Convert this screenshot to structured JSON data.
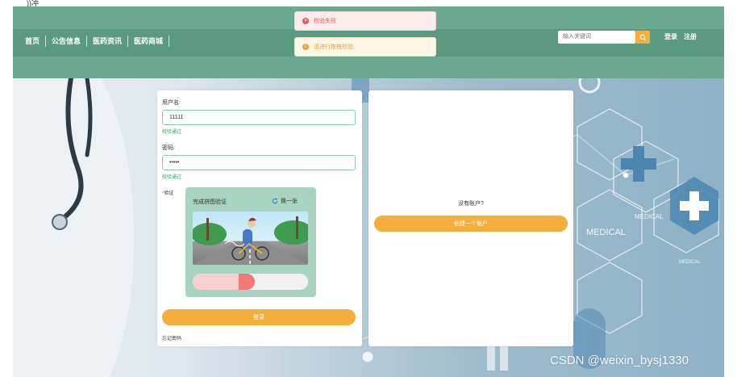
{
  "top_strip": {
    "text": "_ _ ))冲 _"
  },
  "nav": {
    "links": [
      "首页",
      "公告信息",
      "医药资讯",
      "医药商城"
    ],
    "search_placeholder": "输入关键词",
    "login": "登录",
    "register": "注册",
    "search_button_color": "#f5ad3b",
    "bar_color": "#6aa890"
  },
  "toasts": {
    "error": "校验失败",
    "warning": "请进行拖拽校验"
  },
  "login": {
    "username_label": "用户名:",
    "username_value": "11111",
    "username_ok": "校验通过",
    "password_label": "密码:",
    "password_value": "•••••",
    "password_ok": "校验通过",
    "verify_star": "*",
    "verify_label": "验证",
    "captcha_title": "完成拼图验证",
    "captcha_refresh": "换一张",
    "slider_progress": 0.53,
    "submit": "登录",
    "forgot": "忘记密码"
  },
  "register": {
    "no_account": "没有账户?",
    "create": "创建一个账户"
  },
  "background": {
    "medical_1": "MEDICAL",
    "medical_2": "MEDICAL",
    "medical_3": "MEDICAL",
    "accent_color": "#4a86b0"
  },
  "watermark": "CSDN @weixin_bysj1330"
}
